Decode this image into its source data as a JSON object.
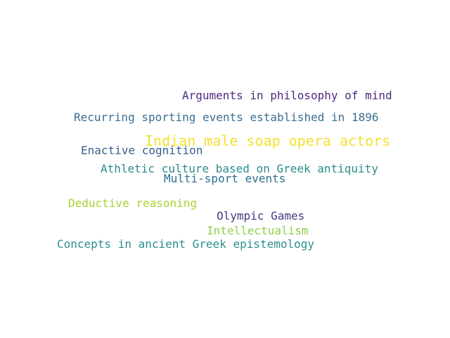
{
  "words": [
    {
      "text": "Arguments in philosophy of mind",
      "color": "#4b2a7f"
    },
    {
      "text": "Recurring sporting events established in 1896",
      "color": "#3b6e91"
    },
    {
      "text": "Indian male soap opera actors",
      "color": "#f3e131"
    },
    {
      "text": "Enactive cognition",
      "color": "#35608d"
    },
    {
      "text": "Athletic culture based on Greek antiquity",
      "color": "#2a8c8a"
    },
    {
      "text": "Multi-sport events",
      "color": "#2e6f8e"
    },
    {
      "text": "Deductive reasoning",
      "color": "#a8d334"
    },
    {
      "text": "Olympic Games",
      "color": "#433b83"
    },
    {
      "text": "Intellectualism",
      "color": "#8fd14a"
    },
    {
      "text": "Concepts in ancient Greek epistemology",
      "color": "#2a8f8c"
    }
  ]
}
